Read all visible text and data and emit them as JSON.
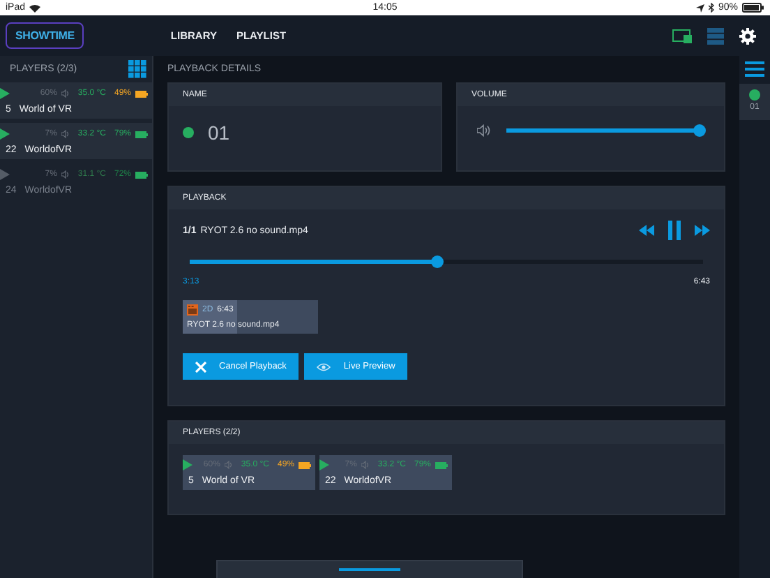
{
  "status_bar": {
    "device": "iPad",
    "time": "14:05",
    "battery": "90%"
  },
  "header": {
    "logo": "SHOWTIME",
    "nav": [
      {
        "label": "LIBRARY"
      },
      {
        "label": "PLAYLIST"
      }
    ]
  },
  "sidebar": {
    "title": "PLAYERS (2/3)",
    "players": [
      {
        "disabled": false,
        "volume": "60%",
        "temperature": "35.0 °C",
        "battery": "49%",
        "color": "#f5a623",
        "number": "5",
        "name": "World of VR"
      },
      {
        "disabled": false,
        "volume": "7%",
        "temperature": "33.2 °C",
        "battery": "79%",
        "color": "#27ae60",
        "number": "22",
        "name": "WorldofVR"
      },
      {
        "disabled": true,
        "volume": "7%",
        "temperature": "31.1 °C",
        "battery": "72%",
        "color": "#27ae60",
        "number": "24",
        "name": "WorldofVR"
      }
    ]
  },
  "details": {
    "title": "PLAYBACK DETAILS",
    "name_card": {
      "label": "NAME",
      "color": "#27ae60",
      "value": "01"
    },
    "volume_card": {
      "label": "VOLUME",
      "level": 0.97
    },
    "playback": {
      "label": "PLAYBACK",
      "index": "1/1",
      "file": "RYOT 2.6 no sound.mp4",
      "level": 0.48,
      "elapsed": "3:13",
      "total": "6:43",
      "clip": {
        "format": "2D",
        "duration": "6:43",
        "name": "RYOT 2.6 no sound.mp4"
      },
      "buttons": [
        {
          "label": "Cancel Playback",
          "kind": "cancel"
        },
        {
          "label": "Live Preview",
          "kind": "preview"
        }
      ]
    },
    "players": {
      "title": "PLAYERS (2/2)",
      "players": [
        {
          "disabled": false,
          "volume": "60%",
          "temperature": "35.0 °C",
          "battery": "49%",
          "color": "#f5a623",
          "number": "5",
          "name": "World of VR"
        },
        {
          "disabled": false,
          "volume": "7%",
          "temperature": "33.2 °C",
          "battery": "79%",
          "color": "#27ae60",
          "number": "22",
          "name": "WorldofVR"
        }
      ]
    }
  },
  "rail": {
    "items": [
      {
        "label": "01",
        "color": "#27ae60"
      }
    ]
  }
}
